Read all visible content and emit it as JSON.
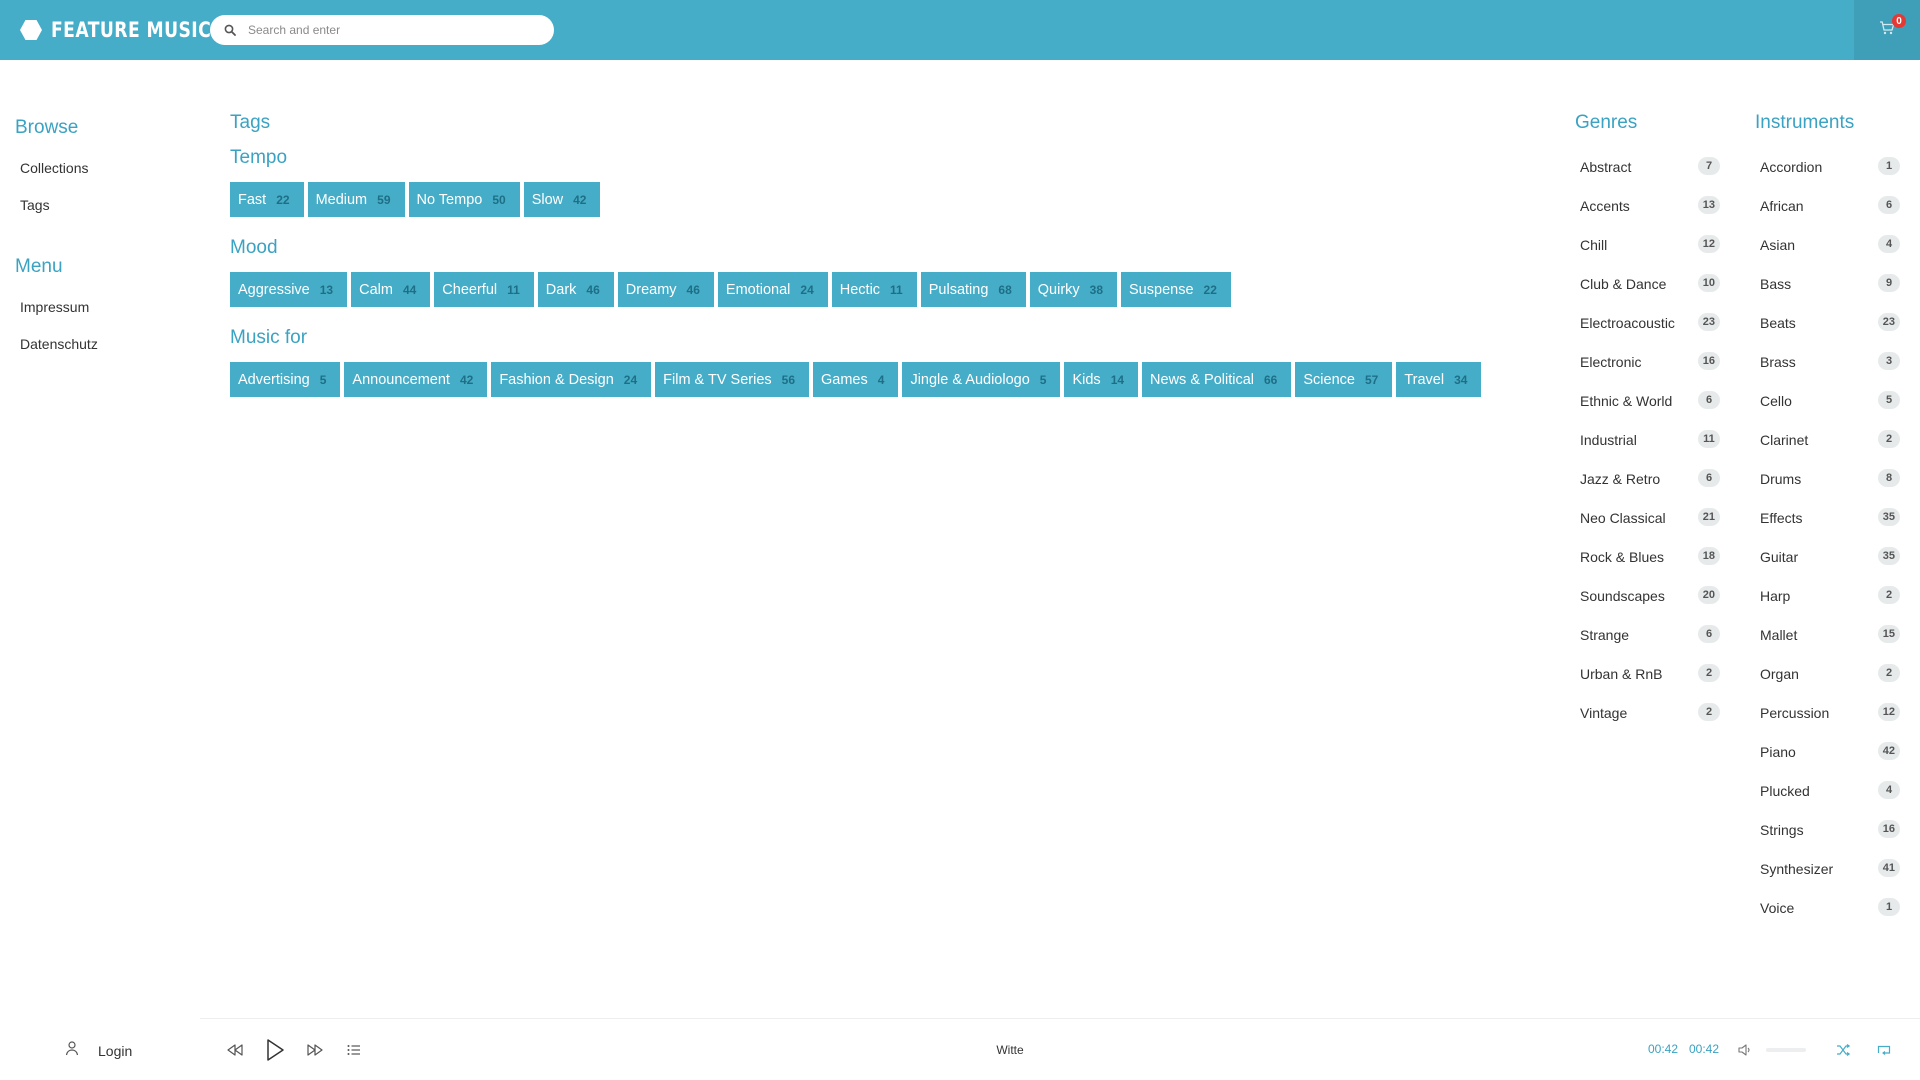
{
  "header": {
    "logo_text": "FEATURE MUSIC",
    "search_placeholder": "Search and enter",
    "cart_count": "0",
    "accent_color": "#46adc8"
  },
  "leftnav": {
    "browse_heading": "Browse",
    "browse_items": [
      "Collections",
      "Tags"
    ],
    "menu_heading": "Menu",
    "menu_items": [
      "Impressum",
      "Datenschutz"
    ]
  },
  "main": {
    "title": "Tags",
    "sections": [
      {
        "title": "Tempo",
        "tags": [
          {
            "label": "Fast",
            "count": "22"
          },
          {
            "label": "Medium",
            "count": "59"
          },
          {
            "label": "No Tempo",
            "count": "50"
          },
          {
            "label": "Slow",
            "count": "42"
          }
        ]
      },
      {
        "title": "Mood",
        "tags": [
          {
            "label": "Aggressive",
            "count": "13"
          },
          {
            "label": "Calm",
            "count": "44"
          },
          {
            "label": "Cheerful",
            "count": "11"
          },
          {
            "label": "Dark",
            "count": "46"
          },
          {
            "label": "Dreamy",
            "count": "46"
          },
          {
            "label": "Emotional",
            "count": "24"
          },
          {
            "label": "Hectic",
            "count": "11"
          },
          {
            "label": "Pulsating",
            "count": "68"
          },
          {
            "label": "Quirky",
            "count": "38"
          },
          {
            "label": "Suspense",
            "count": "22"
          }
        ]
      },
      {
        "title": "Music for",
        "tags": [
          {
            "label": "Advertising",
            "count": "5"
          },
          {
            "label": "Announcement",
            "count": "42"
          },
          {
            "label": "Fashion & Design",
            "count": "24"
          },
          {
            "label": "Film & TV Series",
            "count": "56"
          },
          {
            "label": "Games",
            "count": "4"
          },
          {
            "label": "Jingle & Audiologo",
            "count": "5"
          },
          {
            "label": "Kids",
            "count": "14"
          },
          {
            "label": "News & Political",
            "count": "66"
          },
          {
            "label": "Science",
            "count": "57"
          },
          {
            "label": "Travel",
            "count": "34"
          }
        ]
      }
    ]
  },
  "genres": {
    "heading": "Genres",
    "items": [
      {
        "label": "Abstract",
        "count": "7"
      },
      {
        "label": "Accents",
        "count": "13"
      },
      {
        "label": "Chill",
        "count": "12"
      },
      {
        "label": "Club & Dance",
        "count": "10"
      },
      {
        "label": "Electroacoustic",
        "count": "23"
      },
      {
        "label": "Electronic",
        "count": "16"
      },
      {
        "label": "Ethnic & World",
        "count": "6"
      },
      {
        "label": "Industrial",
        "count": "11"
      },
      {
        "label": "Jazz & Retro",
        "count": "6"
      },
      {
        "label": "Neo Classical",
        "count": "21"
      },
      {
        "label": "Rock & Blues",
        "count": "18"
      },
      {
        "label": "Soundscapes",
        "count": "20"
      },
      {
        "label": "Strange",
        "count": "6"
      },
      {
        "label": "Urban & RnB",
        "count": "2"
      },
      {
        "label": "Vintage",
        "count": "2"
      }
    ]
  },
  "instruments": {
    "heading": "Instruments",
    "items": [
      {
        "label": "Accordion",
        "count": "1"
      },
      {
        "label": "African",
        "count": "6"
      },
      {
        "label": "Asian",
        "count": "4"
      },
      {
        "label": "Bass",
        "count": "9"
      },
      {
        "label": "Beats",
        "count": "23"
      },
      {
        "label": "Brass",
        "count": "3"
      },
      {
        "label": "Cello",
        "count": "5"
      },
      {
        "label": "Clarinet",
        "count": "2"
      },
      {
        "label": "Drums",
        "count": "8"
      },
      {
        "label": "Effects",
        "count": "35"
      },
      {
        "label": "Guitar",
        "count": "35"
      },
      {
        "label": "Harp",
        "count": "2"
      },
      {
        "label": "Mallet",
        "count": "15"
      },
      {
        "label": "Organ",
        "count": "2"
      },
      {
        "label": "Percussion",
        "count": "12"
      },
      {
        "label": "Piano",
        "count": "42"
      },
      {
        "label": "Plucked",
        "count": "4"
      },
      {
        "label": "Strings",
        "count": "16"
      },
      {
        "label": "Synthesizer",
        "count": "41"
      },
      {
        "label": "Voice",
        "count": "1"
      }
    ]
  },
  "player": {
    "login_label": "Login",
    "track_title": "Witte",
    "time_current": "00:42",
    "time_total": "00:42",
    "volume_level": 0
  }
}
